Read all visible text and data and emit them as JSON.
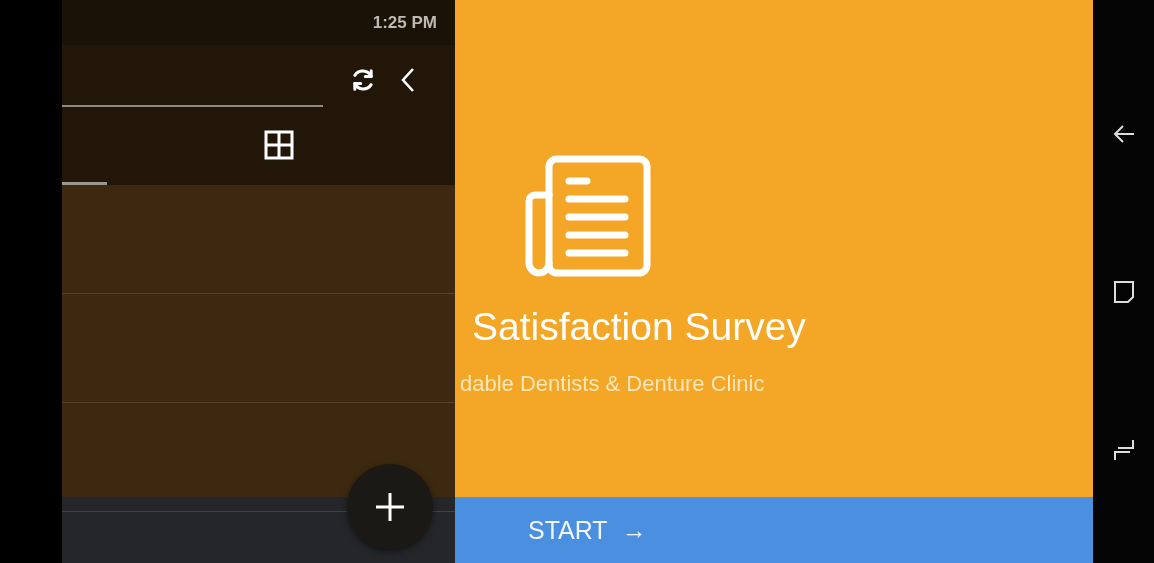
{
  "status_bar": {
    "time": "1:25 PM"
  },
  "drawer": {
    "open": true
  },
  "survey": {
    "title": "Satisfaction Survey",
    "subtitle": "dable Dentists & Denture Clinic"
  },
  "start_button": {
    "label": "START",
    "arrow": "→"
  }
}
